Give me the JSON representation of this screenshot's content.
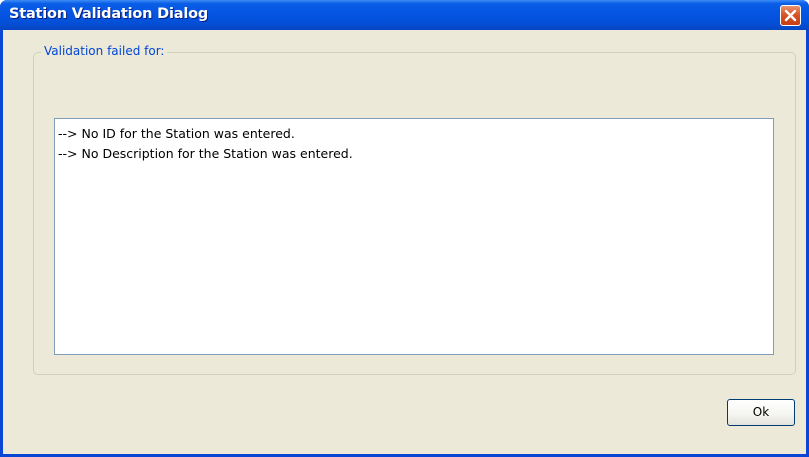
{
  "window": {
    "title": "Station Validation Dialog"
  },
  "group": {
    "legend": "Validation failed for:"
  },
  "messages": [
    "--> No ID for the Station was entered.",
    "--> No Description for the Station was entered."
  ],
  "buttons": {
    "ok_label": "Ok"
  },
  "icons": {
    "close": "close-icon"
  },
  "colors": {
    "titlebar": "#0554e3",
    "close_button": "#d9542a",
    "client_background": "#ece9d8",
    "legend_text": "#0046d5",
    "textbox_border": "#7f9db9"
  }
}
